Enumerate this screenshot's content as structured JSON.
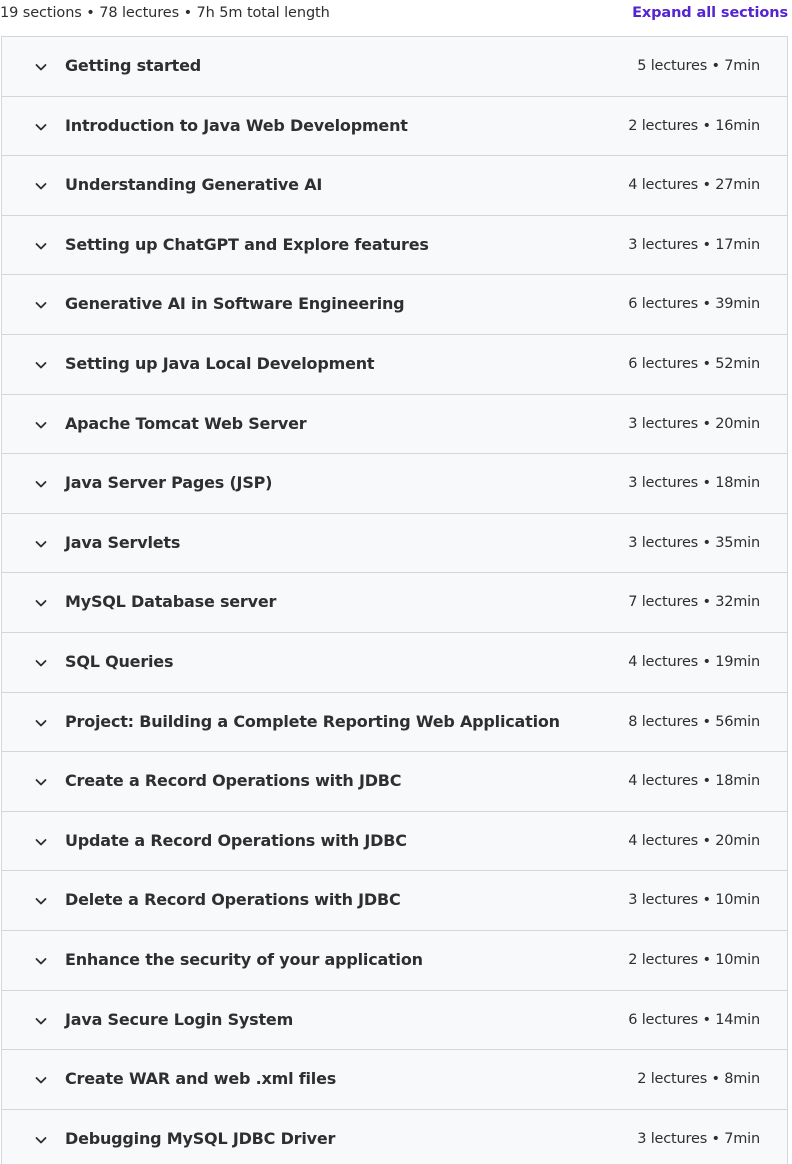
{
  "summary": {
    "text": "19 sections • 78 lectures • 7h 5m total length",
    "expand_label": "Expand all sections"
  },
  "colors": {
    "accent": "#5624d0",
    "row_background": "#f7f9fa",
    "border": "#d1d7dc",
    "text": "#2d2f31"
  },
  "sections": [
    {
      "title": "Getting started",
      "meta": "5 lectures • 7min",
      "icon": "chevron-down-icon"
    },
    {
      "title": "Introduction to Java Web Development",
      "meta": "2 lectures • 16min",
      "icon": "chevron-down-icon"
    },
    {
      "title": "Understanding Generative AI",
      "meta": "4 lectures • 27min",
      "icon": "chevron-down-icon"
    },
    {
      "title": "Setting up ChatGPT and Explore features",
      "meta": "3 lectures • 17min",
      "icon": "chevron-down-icon"
    },
    {
      "title": "Generative AI in Software Engineering",
      "meta": "6 lectures • 39min",
      "icon": "chevron-down-icon"
    },
    {
      "title": "Setting up Java Local Development",
      "meta": "6 lectures • 52min",
      "icon": "chevron-down-icon"
    },
    {
      "title": "Apache Tomcat Web Server",
      "meta": "3 lectures • 20min",
      "icon": "chevron-down-icon"
    },
    {
      "title": "Java Server Pages (JSP)",
      "meta": "3 lectures • 18min",
      "icon": "chevron-down-icon"
    },
    {
      "title": "Java Servlets",
      "meta": "3 lectures • 35min",
      "icon": "chevron-down-icon"
    },
    {
      "title": "MySQL Database server",
      "meta": "7 lectures • 32min",
      "icon": "chevron-down-icon"
    },
    {
      "title": "SQL Queries",
      "meta": "4 lectures • 19min",
      "icon": "chevron-down-icon"
    },
    {
      "title": "Project: Building a Complete Reporting Web Application",
      "meta": "8 lectures • 56min",
      "icon": "chevron-down-icon"
    },
    {
      "title": "Create a Record Operations with JDBC",
      "meta": "4 lectures • 18min",
      "icon": "chevron-down-icon"
    },
    {
      "title": "Update a Record Operations with JDBC",
      "meta": "4 lectures • 20min",
      "icon": "chevron-down-icon"
    },
    {
      "title": "Delete a Record Operations with JDBC",
      "meta": "3 lectures • 10min",
      "icon": "chevron-down-icon"
    },
    {
      "title": "Enhance the security of your application",
      "meta": "2 lectures • 10min",
      "icon": "chevron-down-icon"
    },
    {
      "title": "Java Secure Login System",
      "meta": "6 lectures • 14min",
      "icon": "chevron-down-icon"
    },
    {
      "title": "Create WAR and web .xml files",
      "meta": "2 lectures • 8min",
      "icon": "chevron-down-icon"
    },
    {
      "title": "Debugging MySQL JDBC Driver",
      "meta": "3 lectures • 7min",
      "icon": "chevron-down-icon"
    }
  ]
}
